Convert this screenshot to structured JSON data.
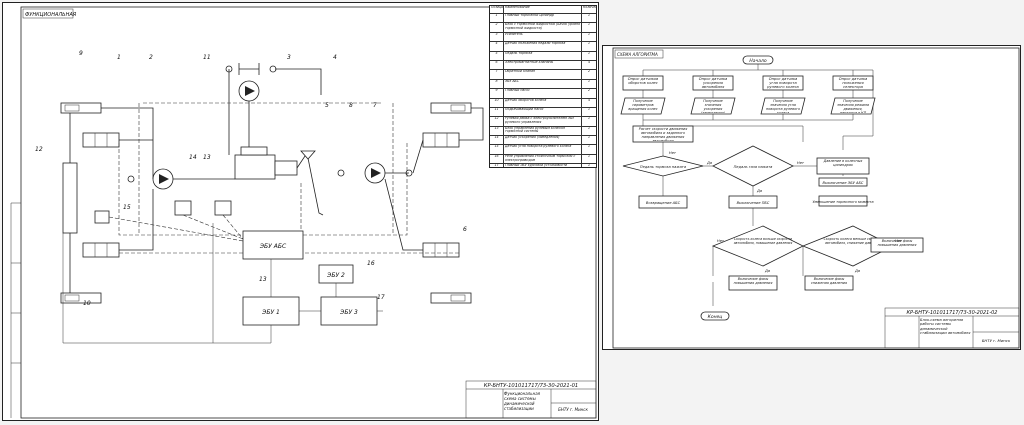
{
  "left_sheet": {
    "stamp": "ФУНКЦИОНАЛЬНАЯ",
    "callouts": [
      "9",
      "1",
      "2",
      "11",
      "3",
      "4",
      "5",
      "8",
      "7",
      "12",
      "14",
      "10",
      "13",
      "6",
      "13",
      "15",
      "17",
      "16"
    ],
    "blocks": [
      "ЭБУ АБС",
      "ЭБУ 2",
      "ЭБУ 1",
      "ЭБУ 3"
    ],
    "table": {
      "headers": [
        "Позиция",
        "Наименование",
        "Количество"
      ],
      "rows": [
        [
          "1",
          "Главный тормозной цилиндр",
          "1"
        ],
        [
          "2",
          "Блок с тормозной жидкостью (Бачок уровня тормозной жидкости)",
          "1"
        ],
        [
          "3",
          "Усилитель",
          "1"
        ],
        [
          "4",
          "Датчик положения педали тормоза",
          "1"
        ],
        [
          "5",
          "Педаль тормоза",
          "1"
        ],
        [
          "6",
          "Электромагнитные клапаны",
          "4"
        ],
        [
          "7",
          "Обратный клапан",
          "2"
        ],
        [
          "8",
          "ЭБУ АБС",
          "1"
        ],
        [
          "9",
          "Главный насос",
          "2"
        ],
        [
          "10",
          "Датчик оборотов колеса",
          "4"
        ],
        [
          "11",
          "Подкачивающий насос",
          "1"
        ],
        [
          "12",
          "Рулевая рейка с электроусилителем ЭБУ рулевого управления",
          "1"
        ],
        [
          "13",
          "Блок управления рулевым колесом тормозной системы",
          "1"
        ],
        [
          "14",
          "Датчик ускорения (замедления)",
          "1"
        ],
        [
          "15",
          "Датчик угла поворота рулевого колеса",
          "1"
        ],
        [
          "16",
          "Реле управления стояночным тормозом с электроприводом",
          "1"
        ],
        [
          "17",
          "Главный ЭБУ курсовой устойчивости",
          "1"
        ],
        [
          "18",
          "Датчик положения рычага переключения передач",
          "1"
        ]
      ]
    },
    "title_block": {
      "doc_code": "КР-БНТУ-101011717/73-30-2021-01",
      "title": "Функциональная схема системы динамической стабилизации",
      "org": "БНТУ г. Минск"
    }
  },
  "right_sheet": {
    "stamp": "СХЕМА АЛГОРИТМА",
    "start": "Начало",
    "end": "Конец",
    "nodes": [
      "Опрос датчиков оборотов колес",
      "Опрос датчика ускорения автомобиля",
      "Опрос датчика угла поворота рулевого колеса",
      "Опрос датчика положения селектора передачи",
      "Получение параметров вращения колес",
      "Получение значения ускорения (замедления) автомобиля",
      "Получение значения угла поворота рулевого колеса",
      "Получение значения режима движения, передачи в КП",
      "Расчет скорости движения автомобиля и заданного направления движения автомобиля",
      "Давление в колесных цилиндрах",
      "Выключение ЭБУ АБС",
      "Уменьшение тормозного момента",
      "Возвращение АБС",
      "Выключение ПБС",
      "Скорость колеса больше скорости автомобиля, повышение давления",
      "Скорость колеса меньше скорости автомобиля, снижение давления",
      "Включение фазы повышения давления",
      "Включение фазы повышения давления",
      "Включение фазы снижения давления"
    ],
    "decisions": [
      "Педаль тормоза нажата",
      "Педаль газа нажата"
    ],
    "branch_labels": [
      "Нет",
      "Да",
      "Нет",
      "Да",
      "Нет",
      "Нет",
      "Да",
      "Да"
    ],
    "title_block": {
      "doc_code": "КР-БНТУ-101011717/73-30-2021-02",
      "title": "Блок-схема алгоритма работы системы динамической стабилизации автомобиля",
      "org": "БНТУ г. Минск"
    }
  }
}
